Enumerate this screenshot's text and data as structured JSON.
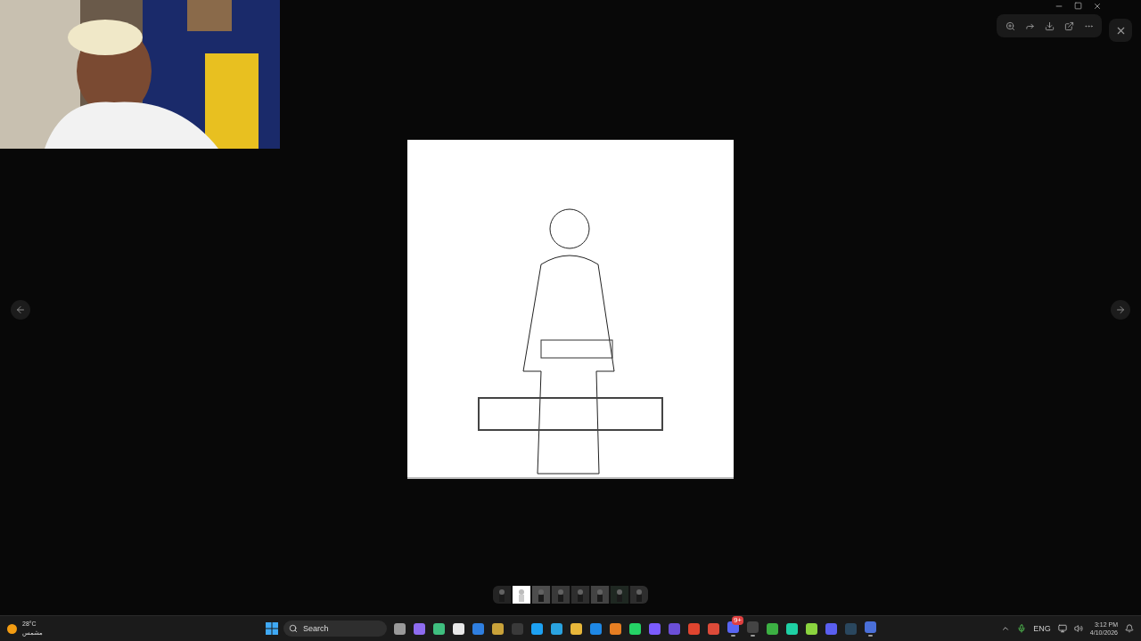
{
  "thumbnails": [
    {
      "selected": false
    },
    {
      "selected": true
    },
    {
      "selected": false
    },
    {
      "selected": false
    },
    {
      "selected": false
    },
    {
      "selected": false
    },
    {
      "selected": false
    },
    {
      "selected": false
    }
  ],
  "taskbar": {
    "weather": {
      "temperature": "28°C",
      "condition": "مشمس"
    },
    "search": {
      "placeholder": "Search"
    },
    "apps": [
      {
        "color": "#9a9a9a",
        "running": false
      },
      {
        "color": "#8e6cf0",
        "running": false
      },
      {
        "color": "#3fbf7f",
        "running": false
      },
      {
        "color": "#e8e8e8",
        "running": false
      },
      {
        "color": "#2f7fe0",
        "running": false
      },
      {
        "color": "#c9a23a",
        "running": false
      },
      {
        "color": "#3a3a3a",
        "running": false
      },
      {
        "color": "#1da1f2",
        "running": false
      },
      {
        "color": "#2aa3e0",
        "running": false
      },
      {
        "color": "#e8b73a",
        "running": false
      },
      {
        "color": "#1e88e5",
        "running": false
      },
      {
        "color": "#e67e22",
        "running": false
      },
      {
        "color": "#25d366",
        "running": false
      },
      {
        "color": "#7b5cff",
        "running": false
      },
      {
        "color": "#6b4fd8",
        "running": false
      },
      {
        "color": "#e0452f",
        "running": false
      },
      {
        "color": "#dd4b39",
        "running": false
      },
      {
        "color": "#5865f2",
        "running": true,
        "badge": "9+"
      },
      {
        "color": "#444444",
        "running": true
      },
      {
        "color": "#3cb043",
        "running": false
      },
      {
        "color": "#1fd1a5",
        "running": false
      },
      {
        "color": "#8bd43f",
        "running": false
      },
      {
        "color": "#5a5ff0",
        "running": false
      },
      {
        "color": "#2a475e",
        "running": false
      },
      {
        "color": "#4a6fd8",
        "running": true
      }
    ],
    "tray": {
      "language": "ENG",
      "time": "3:12 PM",
      "date": "4/10/2026"
    }
  }
}
